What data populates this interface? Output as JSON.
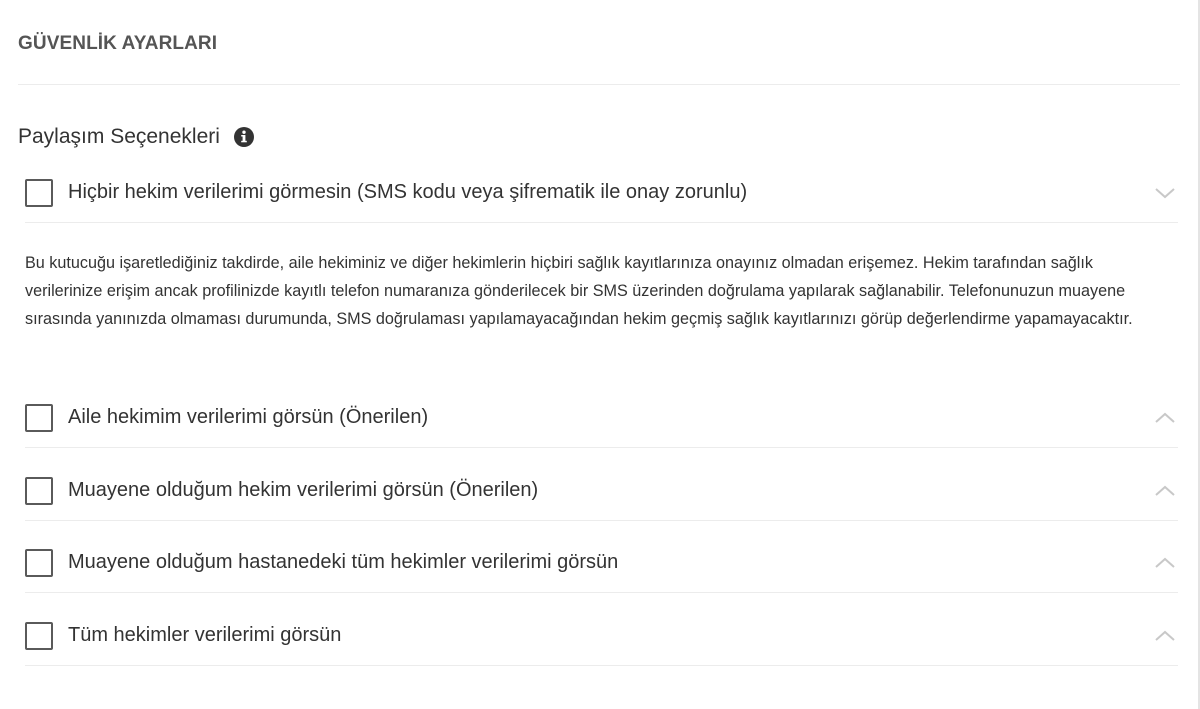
{
  "header": {
    "title": "GÜVENLİK AYARLARI"
  },
  "section": {
    "title": "Paylaşım Seçenekleri",
    "info_icon": "info-circle-icon"
  },
  "options": [
    {
      "label": "Hiçbir hekim verilerimi görmesin (SMS kodu veya şifrematik ile onay zorunlu)",
      "checked": false,
      "expanded": true,
      "chevron": "chevron-down-icon"
    },
    {
      "label": "Aile hekimim verilerimi görsün (Önerilen)",
      "checked": false,
      "expanded": false,
      "chevron": "chevron-up-icon"
    },
    {
      "label": "Muayene olduğum hekim verilerimi görsün (Önerilen)",
      "checked": false,
      "expanded": false,
      "chevron": "chevron-up-icon"
    },
    {
      "label": "Muayene olduğum hastanedeki tüm hekimler verilerimi görsün",
      "checked": false,
      "expanded": false,
      "chevron": "chevron-up-icon"
    },
    {
      "label": "Tüm hekimler verilerimi görsün",
      "checked": false,
      "expanded": false,
      "chevron": "chevron-up-icon"
    }
  ],
  "description": {
    "text": "Bu kutucuğu işaretlediğiniz takdirde, aile hekiminiz ve diğer hekimlerin hiçbiri sağlık kayıtlarınıza onayınız olmadan erişemez. Hekim tarafından sağlık verilerinize erişim ancak profilinizde kayıtlı telefon numaranıza gönderilecek bir SMS üzerinden doğrulama yapılarak sağlanabilir. Telefonunuzun muayene sırasında yanınızda olmaması durumunda, SMS doğrulaması yapılamayacağından hekim geçmiş sağlık kayıtlarınızı görüp değerlendirme yapamayacaktır."
  },
  "colors": {
    "text": "#333333",
    "header": "#555555",
    "divider": "#ececec",
    "chevron": "#c8c8c8"
  }
}
